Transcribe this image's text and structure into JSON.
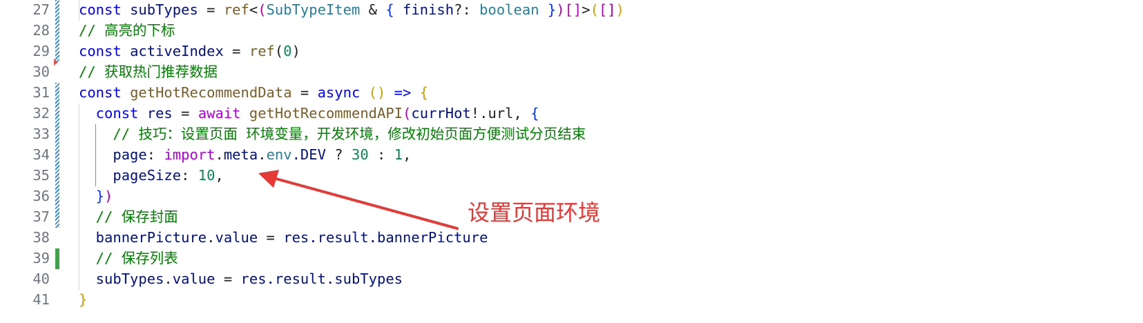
{
  "editor": {
    "lines": [
      {
        "num": "27",
        "tokens": [
          {
            "t": "const ",
            "c": "kw"
          },
          {
            "t": "subTypes",
            "c": "vr"
          },
          {
            "t": " = ",
            "c": "pl"
          },
          {
            "t": "ref",
            "c": "fn"
          },
          {
            "t": "<",
            "c": "pl"
          },
          {
            "t": "(",
            "c": "bp"
          },
          {
            "t": "SubTypeItem",
            "c": "ty"
          },
          {
            "t": " & ",
            "c": "pl"
          },
          {
            "t": "{",
            "c": "b1"
          },
          {
            "t": " finish",
            "c": "vr"
          },
          {
            "t": "?: ",
            "c": "pl"
          },
          {
            "t": "boolean",
            "c": "ty"
          },
          {
            "t": " }",
            "c": "b1"
          },
          {
            "t": ")",
            "c": "bp"
          },
          {
            "t": "[]",
            "c": "bp"
          },
          {
            "t": ">",
            "c": "pl"
          },
          {
            "t": "(",
            "c": "yb"
          },
          {
            "t": "[]",
            "c": "bp"
          },
          {
            "t": ")",
            "c": "yb"
          }
        ]
      },
      {
        "num": "28",
        "tokens": [
          {
            "t": "// 高亮的下标",
            "c": "cm"
          }
        ]
      },
      {
        "num": "29",
        "tokens": [
          {
            "t": "const ",
            "c": "kw"
          },
          {
            "t": "activeIndex",
            "c": "vr"
          },
          {
            "t": " = ",
            "c": "pl"
          },
          {
            "t": "ref",
            "c": "fn"
          },
          {
            "t": "(",
            "c": "pl"
          },
          {
            "t": "0",
            "c": "num"
          },
          {
            "t": ")",
            "c": "pl"
          }
        ]
      },
      {
        "num": "30",
        "tokens": [
          {
            "t": "// 获取热门推荐数据",
            "c": "cm"
          }
        ]
      },
      {
        "num": "31",
        "tokens": [
          {
            "t": "const ",
            "c": "kw"
          },
          {
            "t": "getHotRecommendData",
            "c": "fn"
          },
          {
            "t": " = ",
            "c": "pl"
          },
          {
            "t": "async",
            "c": "kw"
          },
          {
            "t": " ()",
            "c": "yb"
          },
          {
            "t": " => ",
            "c": "kw"
          },
          {
            "t": "{",
            "c": "yb"
          }
        ]
      },
      {
        "num": "32",
        "tokens": [
          {
            "t": "  const ",
            "c": "kw"
          },
          {
            "t": "res",
            "c": "vr"
          },
          {
            "t": " = ",
            "c": "pl"
          },
          {
            "t": "await ",
            "c": "ctl"
          },
          {
            "t": "getHotRecommendAPI",
            "c": "fn"
          },
          {
            "t": "(",
            "c": "bp"
          },
          {
            "t": "currHot",
            "c": "vr"
          },
          {
            "t": "!.url",
            "c": "pl"
          },
          {
            "t": ", ",
            "c": "pl"
          },
          {
            "t": "{",
            "c": "b1"
          }
        ]
      },
      {
        "num": "33",
        "tokens": [
          {
            "t": "    // 技巧：设置页面 环境变量，开发环境，修改初始页面方便测试分页结束",
            "c": "cm"
          }
        ]
      },
      {
        "num": "34",
        "tokens": [
          {
            "t": "    page",
            "c": "vr"
          },
          {
            "t": ": ",
            "c": "pl"
          },
          {
            "t": "import",
            "c": "ctl"
          },
          {
            "t": ".",
            "c": "pl"
          },
          {
            "t": "meta",
            "c": "vr"
          },
          {
            "t": ".",
            "c": "pl"
          },
          {
            "t": "env",
            "c": "ty"
          },
          {
            "t": ".DEV",
            "c": "vr"
          },
          {
            "t": " ? ",
            "c": "pl"
          },
          {
            "t": "30",
            "c": "num"
          },
          {
            "t": " : ",
            "c": "pl"
          },
          {
            "t": "1",
            "c": "num"
          },
          {
            "t": ",",
            "c": "pl"
          }
        ]
      },
      {
        "num": "35",
        "tokens": [
          {
            "t": "    pageSize",
            "c": "vr"
          },
          {
            "t": ": ",
            "c": "pl"
          },
          {
            "t": "10",
            "c": "num"
          },
          {
            "t": ",",
            "c": "pl"
          }
        ]
      },
      {
        "num": "36",
        "tokens": [
          {
            "t": "  }",
            "c": "b1"
          },
          {
            "t": ")",
            "c": "bp"
          }
        ]
      },
      {
        "num": "37",
        "tokens": [
          {
            "t": "  // 保存封面",
            "c": "cm"
          }
        ]
      },
      {
        "num": "38",
        "tokens": [
          {
            "t": "  bannerPicture",
            "c": "vr"
          },
          {
            "t": ".",
            "c": "pl"
          },
          {
            "t": "value",
            "c": "vr"
          },
          {
            "t": " = ",
            "c": "pl"
          },
          {
            "t": "res",
            "c": "vr"
          },
          {
            "t": ".result.bannerPicture",
            "c": "vr"
          }
        ]
      },
      {
        "num": "39",
        "tokens": [
          {
            "t": "  // 保存列表",
            "c": "cm"
          }
        ]
      },
      {
        "num": "40",
        "tokens": [
          {
            "t": "  subTypes",
            "c": "vr"
          },
          {
            "t": ".",
            "c": "pl"
          },
          {
            "t": "value",
            "c": "vr"
          },
          {
            "t": " = ",
            "c": "pl"
          },
          {
            "t": "res",
            "c": "vr"
          },
          {
            "t": ".result.subTypes",
            "c": "vr"
          }
        ]
      },
      {
        "num": "41",
        "tokens": [
          {
            "t": "}",
            "c": "yb"
          }
        ]
      }
    ]
  },
  "annotation": {
    "label": "设置页面环境",
    "color": "#e53935"
  },
  "colors": {
    "keyword": "#0000ff",
    "function": "#795e26",
    "type": "#267f99",
    "variable": "#001080",
    "number": "#098658",
    "comment": "#008000",
    "control": "#af00db",
    "line_number": "#6e7681"
  }
}
